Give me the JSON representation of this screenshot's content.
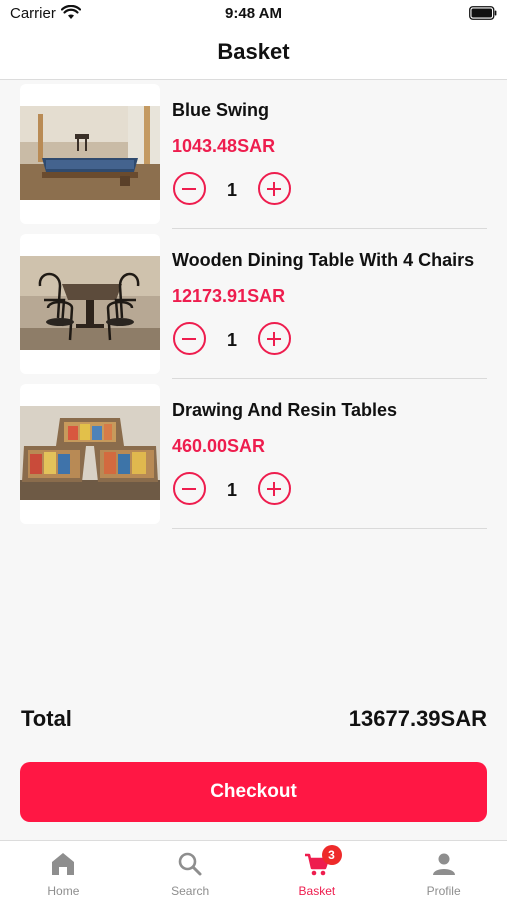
{
  "status_bar": {
    "carrier": "Carrier",
    "time": "9:48 AM"
  },
  "header": {
    "title": "Basket"
  },
  "cart": {
    "items": [
      {
        "name": "Blue Swing",
        "price": "1043.48SAR",
        "quantity": "1"
      },
      {
        "name": "Wooden Dining Table With 4 Chairs",
        "price": "12173.91SAR",
        "quantity": "1"
      },
      {
        "name": "Drawing And Resin Tables",
        "price": "460.00SAR",
        "quantity": "1"
      }
    ]
  },
  "summary": {
    "total_label": "Total",
    "total_value": "13677.39SAR",
    "checkout_label": "Checkout"
  },
  "tab_bar": {
    "tabs": [
      {
        "label": "Home",
        "icon": "home-icon"
      },
      {
        "label": "Search",
        "icon": "search-icon"
      },
      {
        "label": "Basket",
        "icon": "cart-icon",
        "badge": "3",
        "active": true
      },
      {
        "label": "Profile",
        "icon": "person-icon"
      }
    ]
  },
  "colors": {
    "accent": "#ee1d4e",
    "checkout": "#ff1744",
    "badge": "#ee2a2a",
    "inactive": "#8e8e8e"
  }
}
